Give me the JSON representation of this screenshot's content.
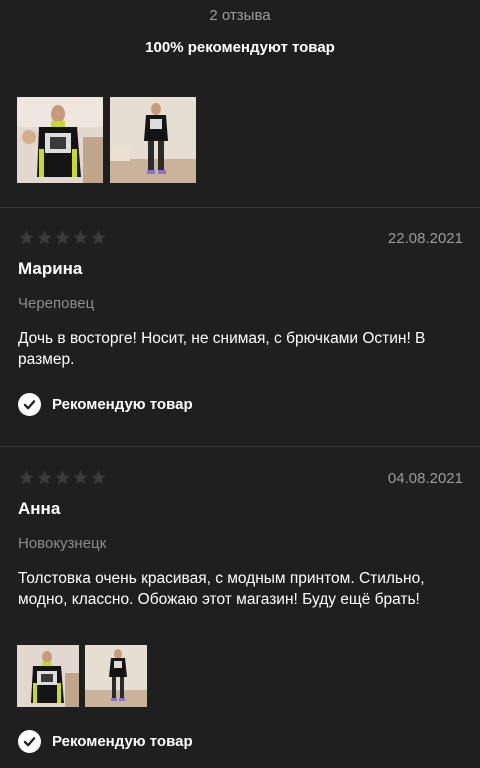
{
  "summary": {
    "review_count": "2 отзыва",
    "recommend_percent": "100% рекомендуют товар"
  },
  "colors": {
    "background": "#1f1f1f",
    "muted_text": "#9b9b9b",
    "divider": "#3b3b3b",
    "star_empty": "#3a3a3a",
    "check_badge": "#ffffff"
  },
  "reviews": [
    {
      "rating": 0,
      "date": "22.08.2021",
      "author": "Марина",
      "city": "Череповец",
      "text": "Дочь в восторге! Носит, не снимая, с брючками Остин! В размер.",
      "recommend_label": "Рекомендую товар",
      "icon": "check-circle-icon"
    },
    {
      "rating": 0,
      "date": "04.08.2021",
      "author": "Анна",
      "city": "Новокузнецк",
      "text": "Толстовка очень красивая, с модным принтом. Стильно, модно, классно. Обожаю этот магазин! Буду ещё брать!",
      "recommend_label": "Рекомендую товар",
      "icon": "check-circle-icon"
    }
  ]
}
